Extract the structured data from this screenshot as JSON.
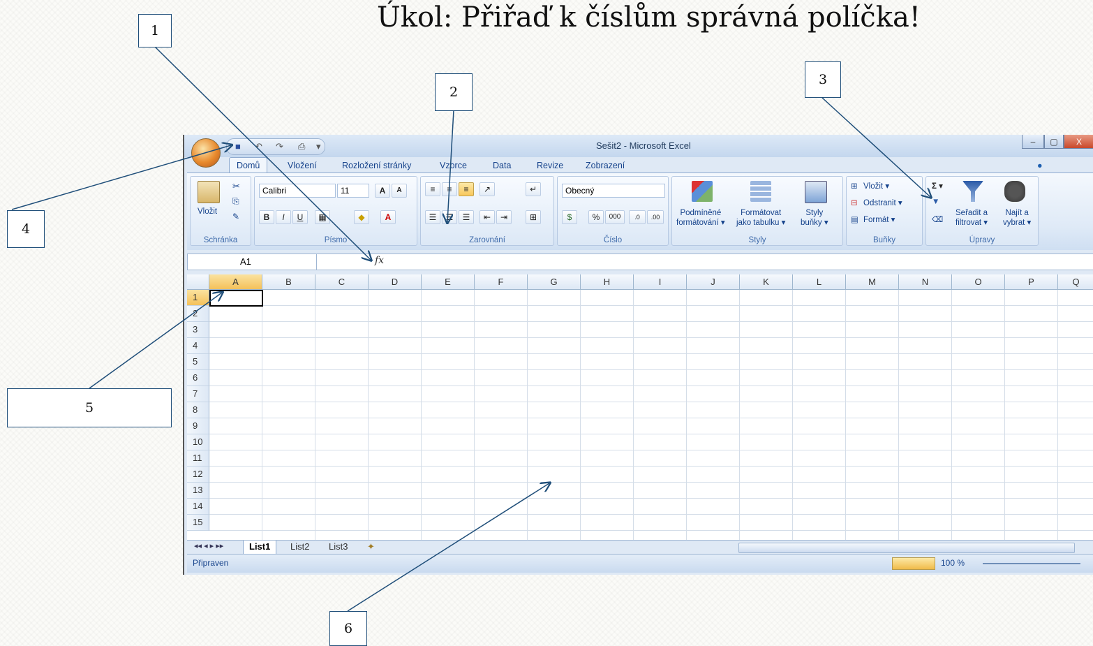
{
  "task_title": "Úkol: Přiřaď k číslům správná políčka!",
  "callouts": [
    "1",
    "2",
    "3",
    "4",
    "5",
    "6"
  ],
  "window": {
    "title": "Sešit2 - Microsoft Excel",
    "minimize": "–",
    "maximize": "▢",
    "close": "X"
  },
  "ribbon_tabs": [
    "Domů",
    "Vložení",
    "Rozložení stránky",
    "Vzorce",
    "Data",
    "Revize",
    "Zobrazení"
  ],
  "groups": {
    "clipboard": {
      "label": "Schránka",
      "paste": "Vložit"
    },
    "font": {
      "label": "Písmo",
      "font_name": "Calibri",
      "font_size": "11",
      "bold": "B",
      "italic": "I",
      "underline": "U",
      "grow": "A",
      "shrink": "A",
      "font_color": "A"
    },
    "alignment": {
      "label": "Zarovnání"
    },
    "number": {
      "label": "Číslo",
      "format": "Obecný",
      "percent": "%",
      "thousands": "000",
      "inc_dec": ",0 ,00",
      "dec_dec": ",00 ,0"
    },
    "styles": {
      "label": "Styly",
      "conditional": "Podmíněné\nformátování ▾",
      "as_table": "Formátovat\njako tabulku ▾",
      "cell_styles": "Styly\nbuňky ▾"
    },
    "cells": {
      "label": "Buňky",
      "insert": "Vložit ▾",
      "delete": "Odstranit ▾",
      "format": "Formát ▾"
    },
    "editing": {
      "label": "Úpravy",
      "sum": "Σ ▾",
      "sort": "Seřadit a\nfiltrovat ▾",
      "find": "Najít a\nvybrat ▾"
    }
  },
  "formula_bar": {
    "name_box": "A1",
    "fx": "fx",
    "value": ""
  },
  "columns": [
    "A",
    "B",
    "C",
    "D",
    "E",
    "F",
    "G",
    "H",
    "I",
    "J",
    "K",
    "L",
    "M",
    "N",
    "O",
    "P",
    "Q"
  ],
  "rows": [
    "1",
    "2",
    "3",
    "4",
    "5",
    "6",
    "7",
    "8",
    "9",
    "10",
    "11",
    "12",
    "13",
    "14",
    "15"
  ],
  "sheets": [
    "List1",
    "List2",
    "List3"
  ],
  "status": {
    "ready": "Připraven",
    "zoom": "100 %"
  },
  "colors": {
    "accent": "#1f4e79",
    "ribbon": "#dfe9f5",
    "selected": "#f4c15a"
  }
}
